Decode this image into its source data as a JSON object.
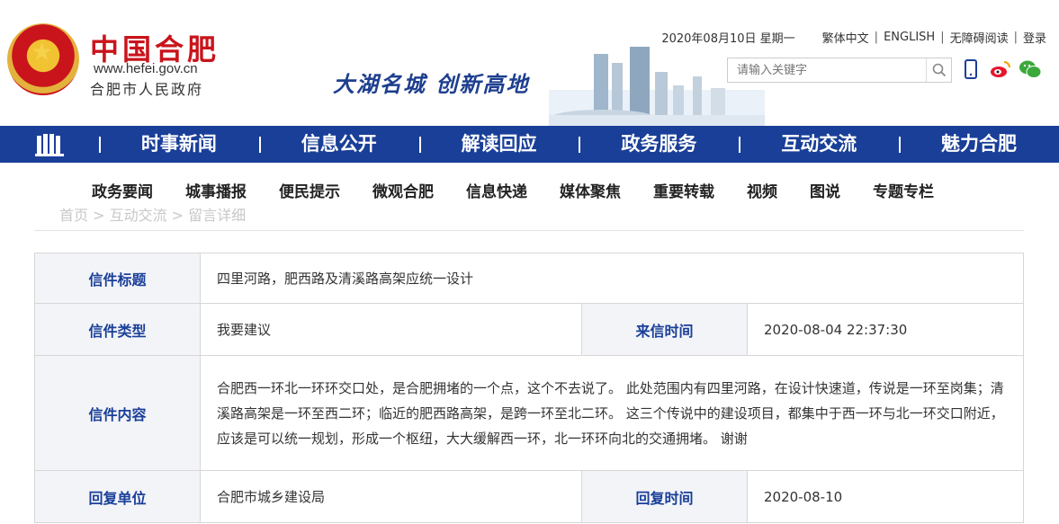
{
  "header": {
    "site_name": "中国合肥",
    "site_url": "www.hefei.gov.cn",
    "site_gov": "合肥市人民政府",
    "slogan": "大湖名城  创新高地",
    "date": "2020年08月10日 星期一",
    "links": [
      "繁体中文",
      "ENGLISH",
      "无障碍阅读",
      "登录"
    ],
    "search_placeholder": "请输入关键字",
    "icons": [
      "mobile-icon",
      "weibo-icon",
      "wechat-icon"
    ]
  },
  "main_nav": {
    "items": [
      "时事新闻",
      "信息公开",
      "解读回应",
      "政务服务",
      "互动交流",
      "魅力合肥"
    ]
  },
  "sub_nav": {
    "items": [
      "政务要闻",
      "城事播报",
      "便民提示",
      "微观合肥",
      "信息快递",
      "媒体聚焦",
      "重要转载",
      "视频",
      "图说",
      "专题专栏"
    ]
  },
  "breadcrumb": "首页 > 互动交流 > 留言详细",
  "letter": {
    "title_label": "信件标题",
    "title_value": "四里河路，肥西路及清溪路高架应统一设计",
    "type_label": "信件类型",
    "type_value": "我要建议",
    "time_label": "来信时间",
    "time_value": "2020-08-04 22:37:30",
    "content_label": "信件内容",
    "content_value": "合肥西一环北一环环交口处，是合肥拥堵的一个点，这个不去说了。 此处范围内有四里河路，在设计快速道，传说是一环至岗集；清溪路高架是一环至西二环；临近的肥西路高架，是跨一环至北二环。 这三个传说中的建设项目，都集中于西一环与北一环交口附近，应该是可以统一规划，形成一个枢纽，大大缓解西一环，北一环环向北的交通拥堵。 谢谢",
    "reply_unit_label": "回复单位",
    "reply_unit_value": "合肥市城乡建设局",
    "reply_time_label": "回复时间",
    "reply_time_value": "2020-08-10"
  },
  "colors": {
    "nav_blue": "#1a3f98",
    "brand_red": "#c9141c"
  }
}
